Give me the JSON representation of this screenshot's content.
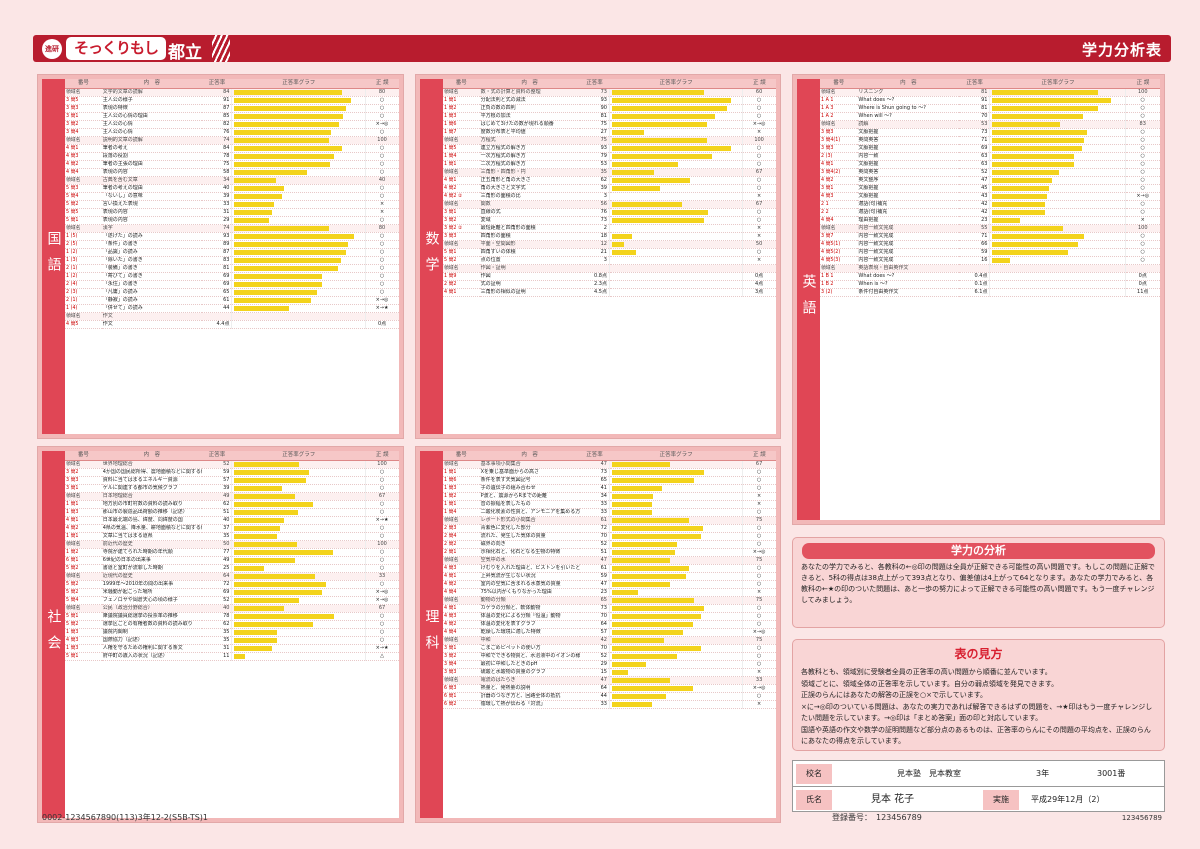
{
  "header": {
    "logo_badge": "進研",
    "logo": "そっくりもし",
    "district": "都立",
    "title": "学力分析表"
  },
  "table_headers": {
    "no": "番号",
    "content": "内　容",
    "rate": "正答率",
    "graph": "正答率グラフ",
    "mark": "正 誤"
  },
  "subjects": {
    "kokugo": "国語",
    "sugaku": "数学",
    "eigo": "英語",
    "shakai": "社会",
    "rika": "理科"
  },
  "kokugo_rows": [
    {
      "dom": true,
      "no": "領域名",
      "c": "文学的文章の読解",
      "v": "84",
      "m": "80"
    },
    {
      "no": "3 問5",
      "c": "主人公の様子",
      "v": "91",
      "m": "○"
    },
    {
      "no": "3 問3",
      "c": "表現の特徴",
      "v": "87",
      "m": "○"
    },
    {
      "no": "3 問1",
      "c": "主人公の心情の理由",
      "v": "85",
      "m": "○"
    },
    {
      "no": "3 問2",
      "c": "主人公の心情",
      "v": "82",
      "m": "×→◎"
    },
    {
      "no": "3 問4",
      "c": "主人公の心情",
      "v": "76",
      "m": "○"
    },
    {
      "dom": true,
      "no": "領域名",
      "c": "説明的文章の読解",
      "v": "74",
      "m": "100"
    },
    {
      "no": "4 問1",
      "c": "筆者の考え",
      "v": "84",
      "m": "○"
    },
    {
      "no": "4 問3",
      "c": "段落の役割",
      "v": "78",
      "m": "○"
    },
    {
      "no": "4 問2",
      "c": "筆者の主張の理由",
      "v": "75",
      "m": "○"
    },
    {
      "no": "4 問4",
      "c": "表現の内容",
      "v": "58",
      "m": "○"
    },
    {
      "dom": true,
      "no": "領域名",
      "c": "古典を含む文章",
      "v": "34",
      "m": "40"
    },
    {
      "no": "5 問3",
      "c": "筆者の考えの理由",
      "v": "40",
      "m": "○"
    },
    {
      "no": "5 問4",
      "c": "「ないし」の意味",
      "v": "39",
      "m": "○"
    },
    {
      "no": "5 問2",
      "c": "言い換えた表現",
      "v": "33",
      "m": "×"
    },
    {
      "no": "5 問5",
      "c": "表現の内容",
      "v": "31",
      "m": "×"
    },
    {
      "no": "5 問1",
      "c": "表現の内容",
      "v": "29",
      "m": "○"
    },
    {
      "dom": true,
      "no": "領域名",
      "c": "漢字",
      "v": "74",
      "m": "80"
    },
    {
      "no": "1 (5)",
      "c": "「遂げた」の読み",
      "v": "93",
      "m": "○"
    },
    {
      "no": "2 (5)",
      "c": "「条件」の書き",
      "v": "89",
      "m": "○"
    },
    {
      "no": "1 (2)",
      "c": "「品識」の読み",
      "v": "87",
      "m": "○"
    },
    {
      "no": "1 (3)",
      "c": "「除いた」の書き",
      "v": "83",
      "m": "○"
    },
    {
      "no": "2 (1)",
      "c": "「装備」の書き",
      "v": "81",
      "m": "○"
    },
    {
      "no": "1 (2)",
      "c": "「寄びて」の書き",
      "v": "69",
      "m": "○"
    },
    {
      "no": "2 (4)",
      "c": "「永住」の書き",
      "v": "69",
      "m": "○"
    },
    {
      "no": "2 (3)",
      "c": "「凡庸」の読み",
      "v": "65",
      "m": "○"
    },
    {
      "no": "2 (1)",
      "c": "「静寂」の読み",
      "v": "61",
      "m": "×→◎"
    },
    {
      "no": "1 (4)",
      "c": "「併せて」の読み",
      "v": "44",
      "m": "×→★"
    },
    {
      "dom": true,
      "no": "領域名",
      "c": "作文",
      "v": "",
      "m": ""
    },
    {
      "no": "4 問5",
      "c": "作文",
      "v": "4.4点",
      "m": "0点"
    }
  ],
  "sugaku_rows": [
    {
      "dom": true,
      "no": "領域名",
      "c": "数・式の計算と資料の整理",
      "v": "73",
      "m": "60"
    },
    {
      "no": "1 問1",
      "c": "分配法則と式の減法",
      "v": "93",
      "m": "○"
    },
    {
      "no": "1 問2",
      "c": "正負の数の四則",
      "v": "90",
      "m": "○"
    },
    {
      "no": "1 問3",
      "c": "平方根の加法",
      "v": "81",
      "m": "○"
    },
    {
      "no": "1 問6",
      "c": "はじめて3けたの数が現れる順番",
      "v": "75",
      "m": "×→◎"
    },
    {
      "no": "1 問7",
      "c": "度数分布表と平均値",
      "v": "27",
      "m": "×"
    },
    {
      "dom": true,
      "no": "領域名",
      "c": "方程式",
      "v": "75",
      "m": "100"
    },
    {
      "no": "1 問5",
      "c": "連立方程式の解き方",
      "v": "93",
      "m": "○"
    },
    {
      "no": "1 問4",
      "c": "一次方程式の解き方",
      "v": "79",
      "m": "○"
    },
    {
      "no": "1 問1",
      "c": "二次方程式の解き方",
      "v": "53",
      "m": "○"
    },
    {
      "dom": true,
      "no": "領域名",
      "c": "三角形・四角形・円",
      "v": "35",
      "m": "67"
    },
    {
      "no": "4 問1",
      "c": "正五角形と角の大きさ",
      "v": "62",
      "m": "○"
    },
    {
      "no": "4 問2",
      "c": "角の大きさと文字式",
      "v": "39",
      "m": "○"
    },
    {
      "no": "4 問2 ②",
      "c": "三角形の面積の比",
      "v": "3",
      "m": "×"
    },
    {
      "dom": true,
      "no": "領域名",
      "c": "関数",
      "v": "56",
      "m": "67"
    },
    {
      "no": "3 問1",
      "c": "直線の式",
      "v": "76",
      "m": "○"
    },
    {
      "no": "3 問2",
      "c": "変域",
      "v": "73",
      "m": "○"
    },
    {
      "no": "3 問2 ②",
      "c": "最短距離と四角形の面積",
      "v": "2",
      "m": "×"
    },
    {
      "no": "3 問3",
      "c": "四角形の面積",
      "v": "18",
      "m": "×"
    },
    {
      "dom": true,
      "no": "領域名",
      "c": "平面・空間図形",
      "v": "12",
      "m": "50"
    },
    {
      "no": "5 問1",
      "c": "四角すいの体積",
      "v": "21",
      "m": "○"
    },
    {
      "no": "5 問2",
      "c": "点の位置",
      "v": "3",
      "m": "×"
    },
    {
      "dom": true,
      "no": "領域名",
      "c": "作図・証明",
      "v": "",
      "m": ""
    },
    {
      "no": "1 問9",
      "c": "作図",
      "v": "0.8点",
      "m": "0点"
    },
    {
      "no": "2 問2",
      "c": "式の証明",
      "v": "2.3点",
      "m": "4点"
    },
    {
      "no": "4 問1",
      "c": "三角形の相似の証明",
      "v": "4.5点",
      "m": "3点"
    }
  ],
  "eigo_rows": [
    {
      "dom": true,
      "no": "領域名",
      "c": "リスニング",
      "v": "81",
      "m": "100"
    },
    {
      "no": "1 A 1",
      "c": "What does ～?",
      "v": "91",
      "m": "○"
    },
    {
      "no": "1 A 3",
      "c": "Where is Shun going to ～?",
      "v": "81",
      "m": "○"
    },
    {
      "no": "1 A 2",
      "c": "When will ～?",
      "v": "70",
      "m": "○"
    },
    {
      "dom": true,
      "no": "領域名",
      "c": "読解",
      "v": "53",
      "m": "83"
    },
    {
      "no": "3 問3",
      "c": "文脈把握",
      "v": "73",
      "m": "○"
    },
    {
      "no": "3 問4(1)",
      "c": "英問英答",
      "v": "71",
      "m": "○"
    },
    {
      "no": "3 問3",
      "c": "文脈把握",
      "v": "69",
      "m": "○"
    },
    {
      "no": "2 (3)",
      "c": "内容一致",
      "v": "63",
      "m": "○"
    },
    {
      "no": "4 問1",
      "c": "文脈把握",
      "v": "63",
      "m": "○"
    },
    {
      "no": "3 問4(2)",
      "c": "英問英答",
      "v": "52",
      "m": "○"
    },
    {
      "no": "4 問2",
      "c": "英文整序",
      "v": "47",
      "m": "○"
    },
    {
      "no": "3 問1",
      "c": "文脈把握",
      "v": "45",
      "m": "○"
    },
    {
      "no": "4 問3",
      "c": "文脈把握",
      "v": "43",
      "m": "×→◎"
    },
    {
      "no": "2 1",
      "c": "適語(句)補充",
      "v": "42",
      "m": "○"
    },
    {
      "no": "2 2",
      "c": "適語(句)補充",
      "v": "42",
      "m": "○"
    },
    {
      "no": "4 問4",
      "c": "理由把握",
      "v": "23",
      "m": "×"
    },
    {
      "dom": true,
      "no": "領域名",
      "c": "内容一致文完成",
      "v": "55",
      "m": "100"
    },
    {
      "no": "3 問7",
      "c": "内容一致文完成",
      "v": "71",
      "m": "○"
    },
    {
      "no": "4 問5(1)",
      "c": "内容一致文完成",
      "v": "66",
      "m": "○"
    },
    {
      "no": "4 問5(2)",
      "c": "内容一致文完成",
      "v": "59",
      "m": "○"
    },
    {
      "no": "4 問5(3)",
      "c": "内容一致文完成",
      "v": "16",
      "m": "○"
    },
    {
      "dom": true,
      "no": "領域名",
      "c": "英語表現・自由英作文",
      "v": "",
      "m": ""
    },
    {
      "no": "1 B 1",
      "c": "What does ～?",
      "v": "0.4点",
      "m": "0点"
    },
    {
      "no": "1 B 2",
      "c": "When is ～?",
      "v": "0.1点",
      "m": "0点"
    },
    {
      "no": "3 (2)",
      "c": "条件付自由英作文",
      "v": "6.1点",
      "m": "11点"
    }
  ],
  "shakai_rows": [
    {
      "dom": true,
      "no": "領域名",
      "c": "世界地理総合",
      "v": "52",
      "m": "100"
    },
    {
      "no": "3 問2",
      "c": "4か国の国民総所得、農地面積などに関する統計",
      "v": "59",
      "m": "○"
    },
    {
      "no": "3 問3",
      "c": "資料に当てはまるエネルギー資源",
      "v": "57",
      "m": "○"
    },
    {
      "no": "3 問1",
      "c": "ゲルに関連する都市の気候グラフ",
      "v": "39",
      "m": "○"
    },
    {
      "dom": true,
      "no": "領域名",
      "c": "日本地理総合",
      "v": "49",
      "m": "67"
    },
    {
      "no": "1 問1",
      "c": "地方別の市町村数の資料の読み取り",
      "v": "62",
      "m": "○"
    },
    {
      "no": "1 問3",
      "c": "那山市の製造品出荷額の推移（記述）",
      "v": "51",
      "m": "○"
    },
    {
      "no": "4 問1",
      "c": "日本最北端の島、緯度、同緯度の国",
      "v": "40",
      "m": "×→★"
    },
    {
      "no": "4 問2",
      "c": "4県の気温、降水量、耕地面積などに関する統計",
      "v": "37",
      "m": "○"
    },
    {
      "no": "1 問1",
      "c": "文章に当てはまる道県",
      "v": "35",
      "m": "○"
    },
    {
      "dom": true,
      "no": "領域名",
      "c": "前近代の歴史",
      "v": "50",
      "m": "100"
    },
    {
      "no": "1 問2",
      "c": "寺院が建てられた時期の年代順",
      "v": "77",
      "m": "○"
    },
    {
      "no": "6 問1",
      "c": "6世紀の日本の出来事",
      "v": "49",
      "m": "○"
    },
    {
      "no": "5 問2",
      "c": "書道と室町が流罪した時期",
      "v": "25",
      "m": "○"
    },
    {
      "dom": true,
      "no": "領域名",
      "c": "近現代の歴史",
      "v": "64",
      "m": "33"
    },
    {
      "no": "5 問2",
      "c": "1999年～2010年の間の出来事",
      "v": "72",
      "m": "○"
    },
    {
      "no": "5 問2",
      "c": "米騒動が起こった場所",
      "v": "69",
      "m": "×→◎"
    },
    {
      "no": "5 問4",
      "c": "フェノロサや岡倉天心の頃の様子",
      "v": "52",
      "m": "×→◎"
    },
    {
      "dom": true,
      "no": "領域名",
      "c": "公民（政治分野総合）",
      "v": "40",
      "m": "67"
    },
    {
      "no": "5 問1",
      "c": "衆議院議員総選挙の投票率の推移",
      "v": "78",
      "m": "○"
    },
    {
      "no": "5 問2",
      "c": "選挙区ごとの有権者数の資料の読み取り",
      "v": "62",
      "m": "○"
    },
    {
      "no": "1 問3",
      "c": "議院内閣制",
      "v": "35",
      "m": "○"
    },
    {
      "no": "4 問3",
      "c": "国際協力（記述）",
      "v": "35",
      "m": "○"
    },
    {
      "no": "1 問3",
      "c": "人権を守るための権利に関する条文",
      "v": "31",
      "m": "×→★"
    },
    {
      "no": "5 問1",
      "c": "府中町の歳入の状況（記述）",
      "v": "11",
      "m": "△"
    }
  ],
  "rika_rows": [
    {
      "dom": true,
      "no": "領域名",
      "c": "基本事項小問集合",
      "v": "47",
      "m": "67"
    },
    {
      "no": "1 問1",
      "c": "Xを乗じ基準面からの高さ",
      "v": "73",
      "m": "○"
    },
    {
      "no": "1 問6",
      "c": "条件を表す天気図記号",
      "v": "65",
      "m": "○"
    },
    {
      "no": "1 問3",
      "c": "子の遺伝子の組み合わせ",
      "v": "41",
      "m": "○"
    },
    {
      "no": "1 問2",
      "c": "P波と、震源からRまでの距離",
      "v": "34",
      "m": "×"
    },
    {
      "no": "1 問1",
      "c": "音の振幅を表したもの",
      "v": "33",
      "m": "×"
    },
    {
      "no": "1 問4",
      "c": "二酸化炭素の性質と、アンモニアを集める方法",
      "v": "33",
      "m": "○"
    },
    {
      "dom": true,
      "no": "領域名",
      "c": "レポート形式の小問集合",
      "v": "61",
      "m": "75"
    },
    {
      "no": "2 問3",
      "c": "青紫色に変化した部分",
      "v": "72",
      "m": "○"
    },
    {
      "no": "2 問4",
      "c": "流れた、発生した気体の質量",
      "v": "70",
      "m": "○"
    },
    {
      "no": "2 問2",
      "c": "磁界の向き",
      "v": "52",
      "m": "○"
    },
    {
      "no": "2 問1",
      "c": "示相化石と、化石となる生物の特徴",
      "v": "51",
      "m": "×→◎"
    },
    {
      "dom": true,
      "no": "領域名",
      "c": "空気中の水",
      "v": "47",
      "m": "75"
    },
    {
      "no": "4 問3",
      "c": "けむりを入れた理由と、ピストンを引いたとき",
      "v": "61",
      "m": "○"
    },
    {
      "no": "4 問1",
      "c": "上昇気流が生じない状況",
      "v": "59",
      "m": "○"
    },
    {
      "no": "4 問2",
      "c": "室内の空気に含まれる水蒸気の質量",
      "v": "47",
      "m": "○"
    },
    {
      "no": "4 問4",
      "c": "75%以内がくもりなかった理由",
      "v": "23",
      "m": "×"
    },
    {
      "dom": true,
      "no": "領域名",
      "c": "動物の分類",
      "v": "65",
      "m": "75"
    },
    {
      "no": "4 問1",
      "c": "カゲラの分類と、軟体動物",
      "v": "73",
      "m": "○"
    },
    {
      "no": "4 問3",
      "c": "体温の変化による分類「恒温」動物",
      "v": "70",
      "m": "○"
    },
    {
      "no": "4 問2",
      "c": "体温の変化を表すグラフ",
      "v": "64",
      "m": "○"
    },
    {
      "no": "4 問4",
      "c": "乾燥した環境に適した特徴",
      "v": "57",
      "m": "×→◎"
    },
    {
      "dom": true,
      "no": "領域名",
      "c": "中和",
      "v": "42",
      "m": "75"
    },
    {
      "no": "3 問1",
      "c": "こまごめピペットの使い方",
      "v": "70",
      "m": "○"
    },
    {
      "no": "3 問2",
      "c": "中和でできる物質と、水溶液中のイオンの様子",
      "v": "52",
      "m": "○"
    },
    {
      "no": "3 問4",
      "c": "最初に中和したときのpH",
      "v": "29",
      "m": "○"
    },
    {
      "no": "3 問3",
      "c": "硫酸と水酸物の質量のグラフ",
      "v": "15",
      "m": "×"
    },
    {
      "dom": true,
      "no": "領域名",
      "c": "電流のはたらき",
      "v": "47",
      "m": "33"
    },
    {
      "no": "6 問3",
      "c": "熱量と、発熱量の説明",
      "v": "64",
      "m": "×→◎"
    },
    {
      "no": "6 問1",
      "c": "計器のつなぎ方と、回路全体の抵抗",
      "v": "44",
      "m": "○"
    },
    {
      "no": "6 問2",
      "c": "循環して熱が伝わる「対流」",
      "v": "33",
      "m": "×"
    }
  ],
  "analysis": {
    "title": "学力の分析",
    "text": "あなたの学力でみると、各教科の←◎印の問題は全員が正解できる可能性の高い問題です。もしこの問題に正解できると、5科の得点は38点上がって393点となり、偏差値は4上がって64となります。あなたの学力でみると、各教科の←★の印のついた問題は、あと一歩の努力によって正解できる可能性の高い問題です。もう一度チャレンジしてみましょう。"
  },
  "legend": {
    "title": "表の見方",
    "lines": [
      "各教科とも、領域別に受験者全員の正答率の高い問題から順番に並んでいます。",
      "領域ごとに、領域全体の正答率を示しています。自分の弱点領域を発見できます。",
      "正誤のらんにはあなたの解答の正誤を○×で示しています。",
      "×に→◎印のついている問題は、あなたの実力であれば解答できるはずの問題を、→★印はもう一度チャレンジしたい問題を示しています。→◎印は「まとめ答案」面の印と対応しています。",
      "国語や英語の作文や数学の証明問題など部分点のあるものは、正答率のらんにその問題の平均点を、正誤のらんにあなたの得点を示しています。"
    ]
  },
  "info": {
    "school_label": "校名",
    "school": "見本塾　見本教室",
    "grade": "3年",
    "number": "3001番",
    "name_label": "氏名",
    "name": "見本 花子",
    "date_label": "実施",
    "date": "平成29年12月（2）"
  },
  "footer": {
    "left": "0002-1234567890(113)3年12-2(S5B-TS)1",
    "reg": "登録番号：　123456789",
    "right": "123456789"
  }
}
